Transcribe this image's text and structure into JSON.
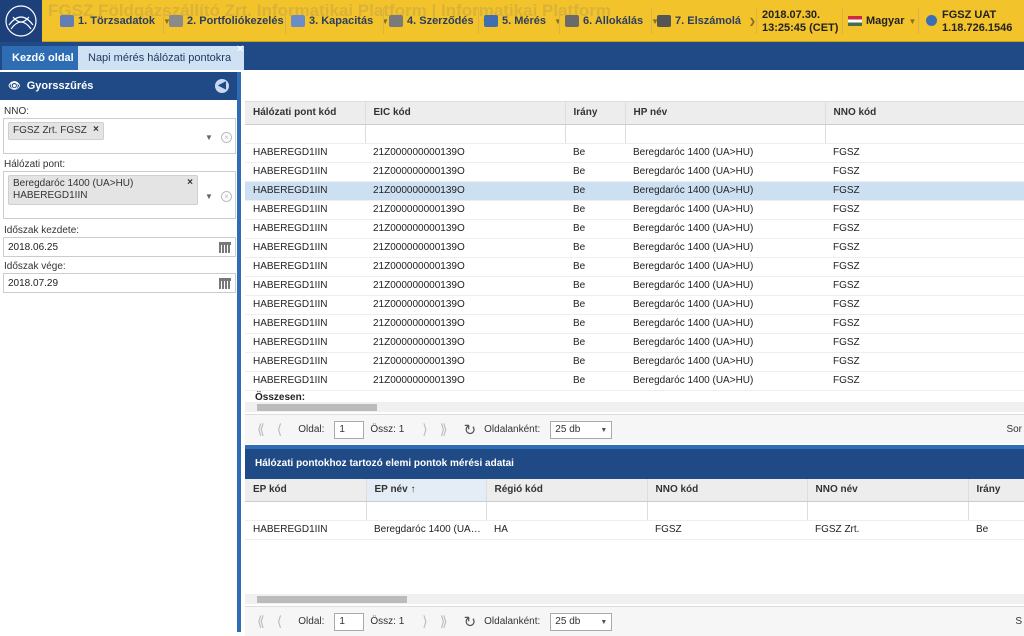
{
  "header": {
    "logo_bg_text": "FGSZ Földgázszállító Zrt. Informatikai Platform | Informatikai Platform",
    "menu": [
      {
        "label": "1. Törzsadatok",
        "icon": "folder-icon"
      },
      {
        "label": "2. Portfoliókezelés",
        "icon": "portfolio-icon"
      },
      {
        "label": "3. Kapacitás",
        "icon": "capacity-icon"
      },
      {
        "label": "4. Szerződés",
        "icon": "contract-icon"
      },
      {
        "label": "5. Mérés",
        "icon": "measure-icon"
      },
      {
        "label": "6. Allokálás",
        "icon": "lock-icon"
      },
      {
        "label": "7. Elszámolá",
        "icon": "printer-icon"
      }
    ],
    "date": "2018.07.30.",
    "time": "13:25:45 (CET)",
    "language": "Magyar",
    "env_name": "FGSZ UAT",
    "version": "1.18.726.1546"
  },
  "tabs": {
    "home": "Kezdő oldal",
    "daily": "Napi mérés hálózati pontokra"
  },
  "sidebar": {
    "title": "Gyorsszűrés",
    "nno_label": "NNO:",
    "nno_value": "FGSZ Zrt. FGSZ",
    "point_label": "Hálózati pont:",
    "point_value_1": "Beregdaróc 1400 (UA>HU)",
    "point_value_2": "HABEREGD1IIN",
    "start_label": "Időszak kezdete:",
    "start_value": "2018.06.25",
    "end_label": "Időszak vége:",
    "end_value": "2018.07.29"
  },
  "grid1": {
    "columns": [
      "Hálózati pont kód",
      "EIC kód",
      "Irány",
      "HP név",
      "NNO kód"
    ],
    "rows": [
      [
        "HABEREGD1IIN",
        "21Z000000000139O",
        "Be",
        "Beregdaróc 1400 (UA>HU)",
        "FGSZ"
      ],
      [
        "HABEREGD1IIN",
        "21Z000000000139O",
        "Be",
        "Beregdaróc 1400 (UA>HU)",
        "FGSZ"
      ],
      [
        "HABEREGD1IIN",
        "21Z000000000139O",
        "Be",
        "Beregdaróc 1400 (UA>HU)",
        "FGSZ"
      ],
      [
        "HABEREGD1IIN",
        "21Z000000000139O",
        "Be",
        "Beregdaróc 1400 (UA>HU)",
        "FGSZ"
      ],
      [
        "HABEREGD1IIN",
        "21Z000000000139O",
        "Be",
        "Beregdaróc 1400 (UA>HU)",
        "FGSZ"
      ],
      [
        "HABEREGD1IIN",
        "21Z000000000139O",
        "Be",
        "Beregdaróc 1400 (UA>HU)",
        "FGSZ"
      ],
      [
        "HABEREGD1IIN",
        "21Z000000000139O",
        "Be",
        "Beregdaróc 1400 (UA>HU)",
        "FGSZ"
      ],
      [
        "HABEREGD1IIN",
        "21Z000000000139O",
        "Be",
        "Beregdaróc 1400 (UA>HU)",
        "FGSZ"
      ],
      [
        "HABEREGD1IIN",
        "21Z000000000139O",
        "Be",
        "Beregdaróc 1400 (UA>HU)",
        "FGSZ"
      ],
      [
        "HABEREGD1IIN",
        "21Z000000000139O",
        "Be",
        "Beregdaróc 1400 (UA>HU)",
        "FGSZ"
      ],
      [
        "HABEREGD1IIN",
        "21Z000000000139O",
        "Be",
        "Beregdaróc 1400 (UA>HU)",
        "FGSZ"
      ],
      [
        "HABEREGD1IIN",
        "21Z000000000139O",
        "Be",
        "Beregdaróc 1400 (UA>HU)",
        "FGSZ"
      ],
      [
        "HABEREGD1IIN",
        "21Z000000000139O",
        "Be",
        "Beregdaróc 1400 (UA>HU)",
        "FGSZ"
      ]
    ],
    "selected_row": 2,
    "sum_label": "Összesen:"
  },
  "pager1": {
    "page_label": "Oldal:",
    "page": "1",
    "total": "Össz: 1",
    "per_page_label": "Oldalanként:",
    "per_page": "25 db",
    "sort_label": "Sor"
  },
  "panel2": {
    "title": "Hálózati pontokhoz tartozó elemi pontok mérési adatai",
    "columns": [
      "EP kód",
      "EP név ↑",
      "Régió kód",
      "NNO kód",
      "NNO név",
      "Irány"
    ],
    "rows": [
      [
        "HABEREGD1IIN",
        "Beregdaróc 1400 (UA…",
        "HA",
        "FGSZ",
        "FGSZ Zrt.",
        "Be"
      ]
    ]
  },
  "pager2": {
    "page_label": "Oldal:",
    "page": "1",
    "total": "Össz: 1",
    "per_page_label": "Oldalanként:",
    "per_page": "25 db",
    "sort_label": "S"
  }
}
